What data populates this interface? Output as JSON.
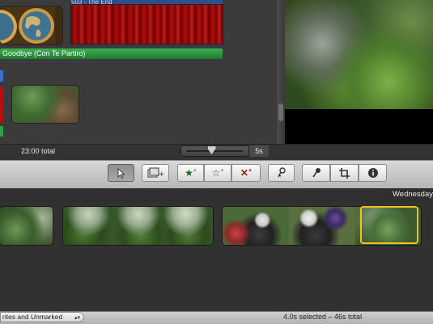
{
  "project": {
    "title_clip_label": "503 - The End",
    "music_track_label": "Goodbye (Con Te Partiro)",
    "total_label": "23:00 total"
  },
  "zoom": {
    "value_label": "5s",
    "level": 0.45
  },
  "toolbar": {
    "buttons": [
      {
        "name": "arrow-select-button",
        "icon": "arrow-icon"
      },
      {
        "name": "add-to-project-button",
        "icon": "add-clip-icon"
      },
      {
        "name": "mark-favorite-button",
        "icon": "star-filled-icon"
      },
      {
        "name": "unmark-button",
        "icon": "star-outline-icon"
      },
      {
        "name": "reject-button",
        "icon": "reject-icon"
      },
      {
        "name": "keyword-button",
        "icon": "key-icon"
      },
      {
        "name": "voiceover-button",
        "icon": "microphone-icon"
      },
      {
        "name": "crop-button",
        "icon": "crop-icon"
      },
      {
        "name": "inspector-button",
        "icon": "info-icon"
      }
    ]
  },
  "event_browser": {
    "date_label": "Wednesday"
  },
  "bottom": {
    "filter_label": "rites and Unmarked",
    "selection_status": "4.0s selected – 46s total"
  },
  "colors": {
    "selection": "#f4c219",
    "music_track": "#2f9a41",
    "favorite_star": "#0f6b2a",
    "reject_x": "#9a1a1a"
  }
}
